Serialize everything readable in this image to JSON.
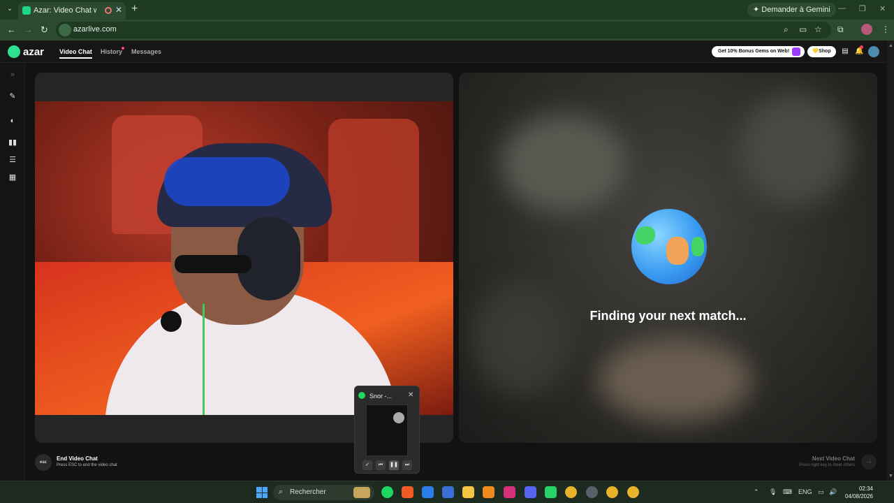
{
  "browser": {
    "tab_title": "Azar: Video Chat with New",
    "new_tab_symbol": "+",
    "gemini_label": "Demander à Gemini",
    "url": "azarlive.com"
  },
  "app": {
    "logo_text": "azar",
    "nav": {
      "video_chat": "Video Chat",
      "history": "History",
      "messages": "Messages"
    },
    "promo_label": "Get 10% Bonus Gems on Web!",
    "shop_label": "Shop",
    "finding_text": "Finding your next match...",
    "end_badge": "esc",
    "end_title": "End Video Chat",
    "end_sub": "Press ESC to end the video chat",
    "next_title": "Next Video Chat",
    "next_sub": "Press right key to meet others"
  },
  "spotify_popup": {
    "title": "Snor -..."
  },
  "taskbar": {
    "search_placeholder": "Rechercher",
    "lang": "ENG",
    "time": "02:34",
    "date": "04/08/2026"
  },
  "colors": {
    "chrome_frame": "#1f3a23",
    "azar_accent": "#2fe08f",
    "spotify_green": "#1ed760"
  }
}
